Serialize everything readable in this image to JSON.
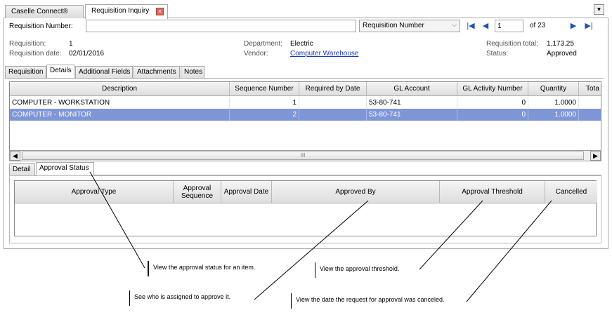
{
  "tabs": [
    {
      "label": "Caselle Connect®"
    },
    {
      "label": "Requisition Inquiry"
    }
  ],
  "search": {
    "label": "Requisition Number:",
    "value": "",
    "mode": "Requisition Number",
    "page": "1",
    "page_total": "of 23"
  },
  "info": {
    "requisition_label": "Requisition:",
    "requisition_value": "1",
    "date_label": "Requisition date:",
    "date_value": "02/01/2016",
    "department_label": "Department:",
    "department_value": "Electric",
    "vendor_label": "Vendor:",
    "vendor_value": "Computer Warehouse",
    "total_label": "Requisition total:",
    "total_value": "1,173.25",
    "status_label": "Status:",
    "status_value": "Approved"
  },
  "subtabs": [
    "Requisition",
    "Details",
    "Additional Fields",
    "Attachments",
    "Notes"
  ],
  "details_grid": {
    "columns": [
      "Description",
      "Sequence Number",
      "Required by Date",
      "GL Account",
      "GL Activity Number",
      "Quantity",
      "Tota"
    ],
    "rows": [
      [
        "COMPUTER - WORKSTATION",
        "1",
        "",
        "53-80-741",
        "0",
        "1.0000",
        ""
      ],
      [
        "COMPUTER - MONITOR",
        "2",
        "",
        "53-80-741",
        "0",
        "1.0000",
        ""
      ]
    ],
    "selected_row": 1,
    "scroll_grip": "III"
  },
  "bottom_tabs": [
    "Detail",
    "Approval Status"
  ],
  "approval_grid": {
    "columns": [
      "Approval Type",
      "Approval Sequence",
      "Approval Date",
      "Approved By",
      "Approval Threshold",
      "Cancelled"
    ]
  },
  "callouts": {
    "status": "View the approval status for an item.",
    "threshold": "View the approval threshold.",
    "assigned": "See who is assigned to approve it.",
    "cancelled": "View the date the request for approval was canceled."
  },
  "colors": {
    "selected_row": "#7f96d6",
    "link": "#1a39b8",
    "tab_close": "#d86a5a"
  }
}
